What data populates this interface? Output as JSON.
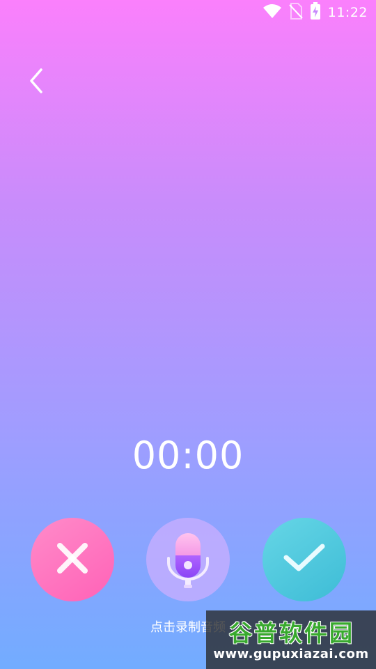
{
  "status_bar": {
    "time": "11:22",
    "icons": [
      "wifi-icon",
      "no-sim-icon",
      "battery-charging-icon"
    ]
  },
  "navigation": {
    "back_icon": "chevron-left-icon"
  },
  "recorder": {
    "timer": "00:00",
    "hint": "点击录制音频",
    "cancel_icon": "close-icon",
    "record_icon": "microphone-icon",
    "confirm_icon": "check-icon"
  },
  "colors": {
    "gradient_top": "#fb80fc",
    "gradient_bottom": "#72acff",
    "cancel": "#ff6fbd",
    "record": "#cdb0ff",
    "confirm": "#4cc8dd",
    "mic_accent": "#9b4dff"
  },
  "watermark": {
    "title": "谷普软件园",
    "url": "www.gupuxiazai.com"
  }
}
